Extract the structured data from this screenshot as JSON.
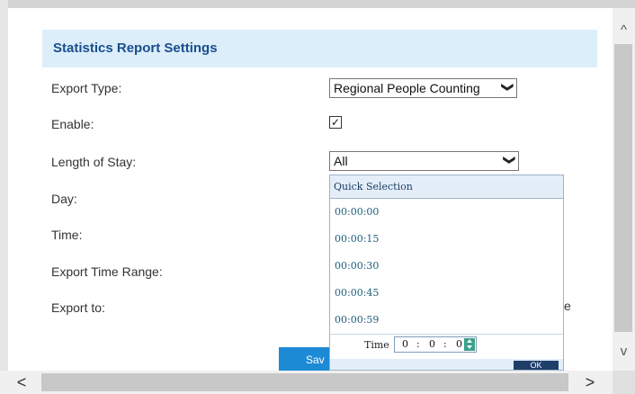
{
  "panel": {
    "title": "Statistics Report Settings"
  },
  "form": {
    "export_type_label": "Export Type:",
    "export_type_value": "Regional People Counting",
    "enable_label": "Enable:",
    "enable_checked": true,
    "length_of_stay_label": "Length of Stay:",
    "length_of_stay_value": "All",
    "day_label": "Day:",
    "time_label": "Time:",
    "export_time_range_label": "Export Time Range:",
    "export_to_label": "Export to:",
    "export_to_trailing_text": "e",
    "save_label": "Sav"
  },
  "time_picker": {
    "header": "Quick Selection",
    "options": [
      "00:00:00",
      "00:00:15",
      "00:00:30",
      "00:00:45",
      "00:00:59"
    ],
    "time_label": "Time",
    "hour": "0",
    "minute": "0",
    "second": "0",
    "separator": ":",
    "ok_label": "OK"
  },
  "icons": {
    "chevron": "❯",
    "check": "✓",
    "scroll_up": "^",
    "scroll_down": "v",
    "scroll_left": "<",
    "scroll_right": ">"
  }
}
